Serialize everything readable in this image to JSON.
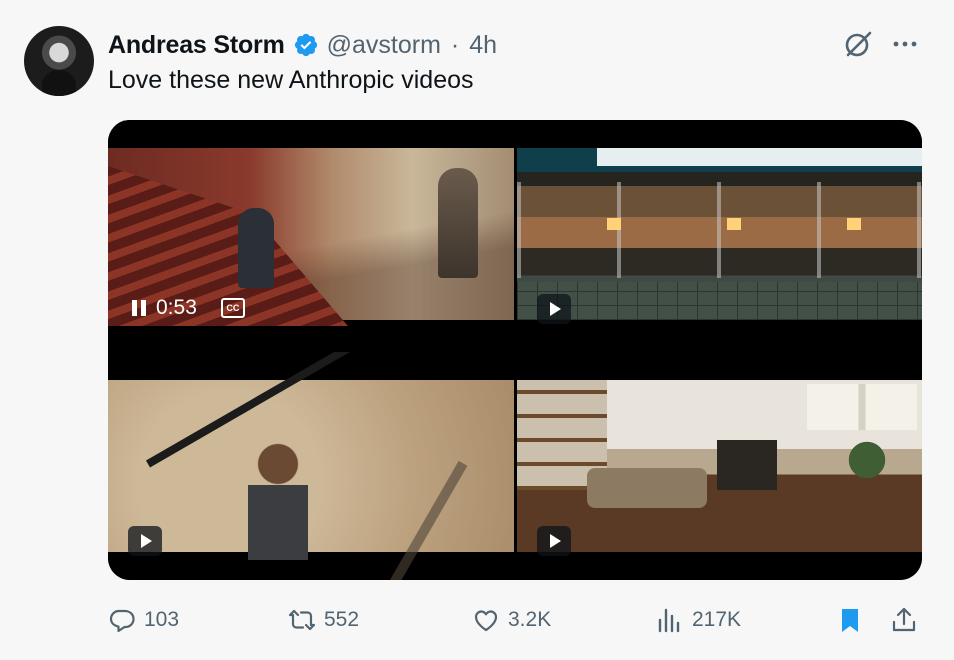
{
  "author": {
    "name": "Andreas Storm",
    "handle": "@avstorm",
    "separator": "·",
    "time": "4h",
    "avatar_icon": "avatar",
    "verified_icon": "verified-badge-icon",
    "verified_color": "#1d9bf0"
  },
  "tweet": {
    "text": "Love these new Anthropic videos"
  },
  "header_icons": [
    "grok-icon",
    "more-icon"
  ],
  "media": {
    "tiles": [
      {
        "position": "top-left",
        "state": "playing",
        "time": "0:53",
        "cc_label": "CC"
      },
      {
        "position": "top-right",
        "state": "paused"
      },
      {
        "position": "bottom-left",
        "state": "paused"
      },
      {
        "position": "bottom-right",
        "state": "paused"
      }
    ]
  },
  "actions": {
    "reply": {
      "icon": "reply-icon",
      "count": "103"
    },
    "retweet": {
      "icon": "retweet-icon",
      "count": "552"
    },
    "like": {
      "icon": "heart-icon",
      "count": "3.2K"
    },
    "views": {
      "icon": "views-icon",
      "count": "217K"
    },
    "bookmark": {
      "icon": "bookmark-icon",
      "color": "#1d9bf0"
    },
    "share": {
      "icon": "share-icon"
    }
  },
  "colors": {
    "accent": "#1d9bf0",
    "text_primary": "#0f1419",
    "text_secondary": "#536471",
    "background": "#f7f7f7"
  }
}
